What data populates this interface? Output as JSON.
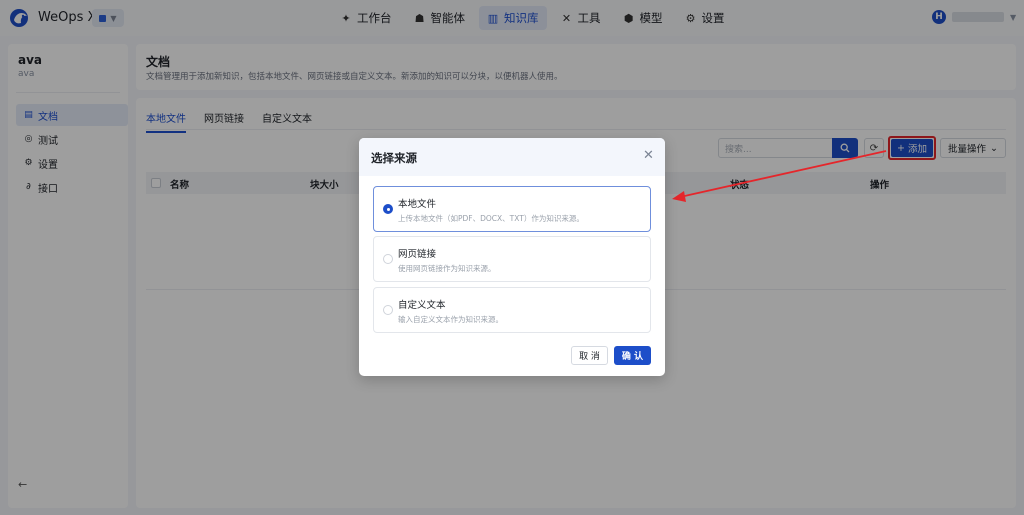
{
  "app": {
    "title": "WeOps X",
    "user_initial": "H"
  },
  "nav": [
    {
      "label": "工作台",
      "icon": "studio-icon"
    },
    {
      "label": "智能体",
      "icon": "bot-icon"
    },
    {
      "label": "知识库",
      "icon": "library-icon",
      "active": true
    },
    {
      "label": "工具",
      "icon": "tools-icon"
    },
    {
      "label": "模型",
      "icon": "cube-icon"
    },
    {
      "label": "设置",
      "icon": "gear-icon"
    }
  ],
  "sidebar": {
    "kb_name": "ava",
    "kb_sub": "ava",
    "items": [
      {
        "label": "文档",
        "active": true
      },
      {
        "label": "测试"
      },
      {
        "label": "设置"
      },
      {
        "label": "接口"
      }
    ],
    "collapse_glyph": "←"
  },
  "header": {
    "title": "文档",
    "description": "文档管理用于添加新知识，包括本地文件、网页链接或自定义文本。新添加的知识可以分块，以便机器人使用。"
  },
  "tabs": [
    {
      "label": "本地文件",
      "active": true
    },
    {
      "label": "网页链接"
    },
    {
      "label": "自定义文本"
    }
  ],
  "toolbar": {
    "search_placeholder": "搜索...",
    "add_label": "添加",
    "bulk_label": "批量操作"
  },
  "table": {
    "columns": [
      "名称",
      "块大小",
      "状态",
      "操作"
    ]
  },
  "modal": {
    "title": "选择来源",
    "options": [
      {
        "title": "本地文件",
        "desc": "上传本地文件（如PDF、DOCX、TXT）作为知识来源。",
        "selected": true
      },
      {
        "title": "网页链接",
        "desc": "使用网页链接作为知识来源。",
        "selected": false
      },
      {
        "title": "自定义文本",
        "desc": "输入自定义文本作为知识来源。",
        "selected": false
      }
    ],
    "cancel_label": "取 消",
    "ok_label": "确 认"
  },
  "colors": {
    "primary": "#1d4ec9",
    "highlight": "#e5262b"
  }
}
